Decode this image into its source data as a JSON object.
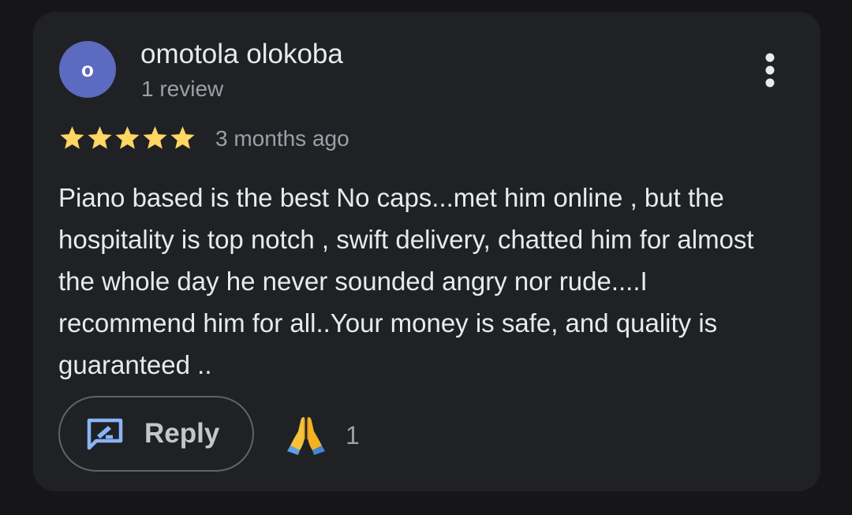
{
  "review": {
    "avatar_initial": "o",
    "author_name": "omotola olokoba",
    "review_count": "1 review",
    "rating": 5,
    "rating_max": 5,
    "time_ago": "3 months ago",
    "text": "Piano based is the best No caps...met him online , but the hospitality is top notch , swift delivery, chatted him for almost the whole day he never sounded angry nor rude....I recommend him for all..Your money is safe, and quality is guaranteed .."
  },
  "actions": {
    "reply_label": "Reply",
    "reply_icon": "rate-review-icon",
    "more_icon": "more-vert-icon",
    "reaction_icon": "folded-hands-emoji",
    "reaction_count": "1"
  },
  "colors": {
    "avatar": "#5c6bc0",
    "star": "#fdd663",
    "reply_icon": "#8ab4f8",
    "card": "#202124",
    "background": "#161618"
  }
}
